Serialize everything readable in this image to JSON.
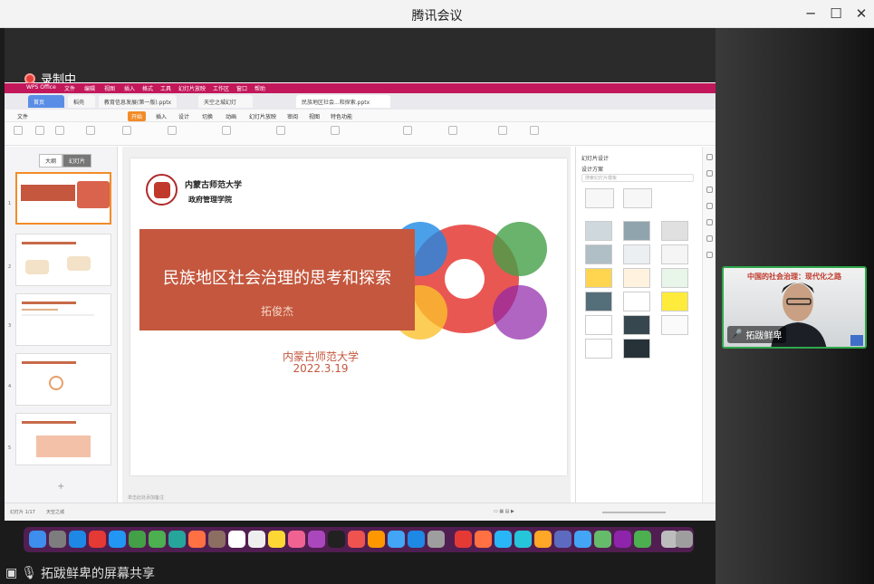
{
  "window": {
    "title": "腾讯会议"
  },
  "recording": {
    "label": "录制中"
  },
  "share": {
    "label": "拓跋鲜卑的屏幕共享"
  },
  "mac_menu": {
    "app": "WPS Office",
    "items": [
      "文件",
      "编辑",
      "视图",
      "插入",
      "格式",
      "工具",
      "幻灯片放映",
      "工作区",
      "窗口",
      "帮助"
    ]
  },
  "wps_tabs": [
    "首页",
    "稻壳",
    "教育信息发展(第一版).pptx",
    "天空之城幻灯",
    "民族地区社会...和探索.pptx"
  ],
  "ribbon_menu": {
    "items": [
      "文件",
      "开始",
      "插入",
      "设计",
      "切换",
      "动画",
      "幻灯片放映",
      "审阅",
      "视图",
      "特色功能"
    ],
    "active": "开始"
  },
  "panel_tabs": [
    "大纲",
    "幻灯片"
  ],
  "slide": {
    "university": "内蒙古师范大学",
    "school": "政府管理学院",
    "title": "民族地区社会治理的思考和探索",
    "author": "拓俊杰",
    "org": "内蒙古师范大学",
    "date": "2022.3.19"
  },
  "right_panel": {
    "title": "幻灯片设计",
    "search_placeholder": "搜索幻灯片模板",
    "section": "设计方案"
  },
  "status": {
    "slide_no": "幻灯片 1/17",
    "theme": "天空之城",
    "notes": "单击此处添加备注"
  },
  "video": {
    "caption": "中国的社会治理：现代化之路",
    "name": "拓跋鲜卑"
  },
  "colors": {
    "title_box": "#c4573e",
    "mac_bar": "#c2185b",
    "video_border": "#2ea84a"
  }
}
